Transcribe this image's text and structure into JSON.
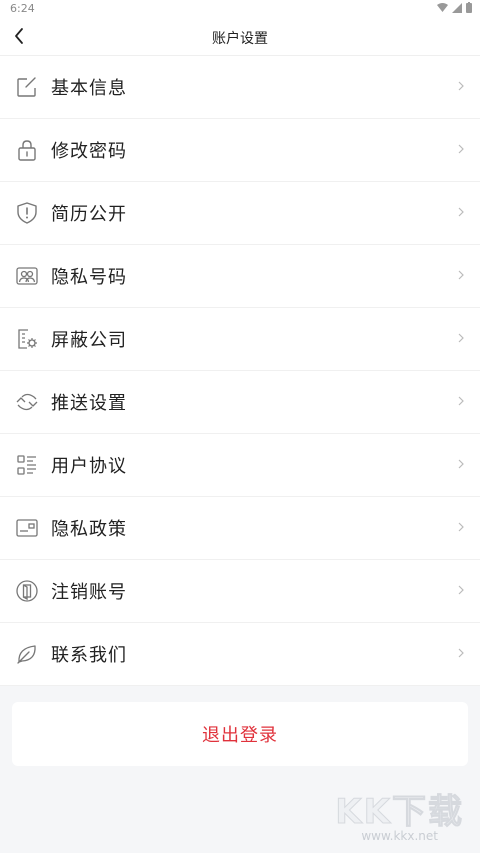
{
  "status_bar": {
    "time": "6:24"
  },
  "header": {
    "title": "账户设置"
  },
  "menu": [
    {
      "label": "基本信息",
      "icon": "edit-icon"
    },
    {
      "label": "修改密码",
      "icon": "lock-icon"
    },
    {
      "label": "简历公开",
      "icon": "shield-alert-icon"
    },
    {
      "label": "隐私号码",
      "icon": "users-icon"
    },
    {
      "label": "屏蔽公司",
      "icon": "building-settings-icon"
    },
    {
      "label": "推送设置",
      "icon": "sync-arrows-icon"
    },
    {
      "label": "用户协议",
      "icon": "list-icon"
    },
    {
      "label": "隐私政策",
      "icon": "id-card-icon"
    },
    {
      "label": "注销账号",
      "icon": "exit-door-icon"
    },
    {
      "label": "联系我们",
      "icon": "leaf-icon"
    }
  ],
  "logout": {
    "label": "退出登录",
    "color": "#e0313b"
  },
  "watermark": {
    "main": "KK下载",
    "sub": "www.kkx.net"
  }
}
